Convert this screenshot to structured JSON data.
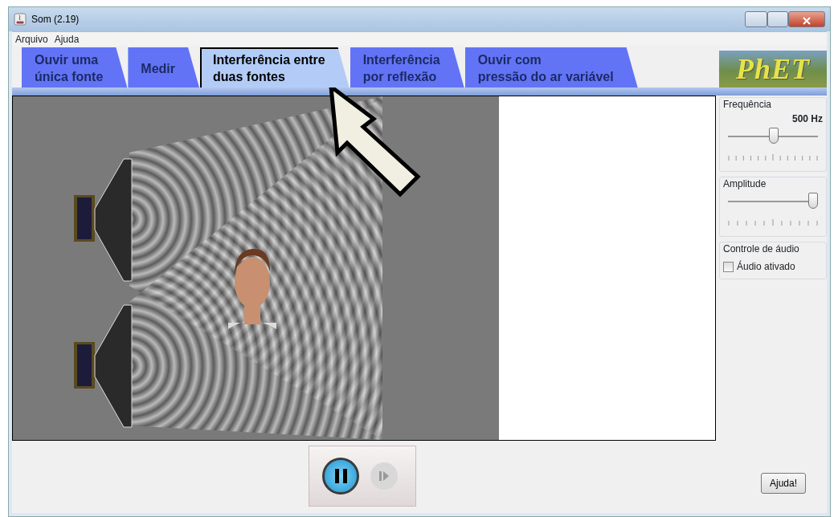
{
  "window": {
    "title": "Som (2.19)"
  },
  "menu": [
    "Arquivo",
    "Ajuda"
  ],
  "tabs": [
    {
      "label": "Ouvir uma\núnica fonte",
      "selected": false
    },
    {
      "label": "Medir",
      "selected": false
    },
    {
      "label": "Interferência entre\nduas fontes",
      "selected": true
    },
    {
      "label": "Interferência\npor reflexão",
      "selected": false
    },
    {
      "label": "Ouvir com\npressão do ar variável",
      "selected": false
    }
  ],
  "logo": "PhET",
  "controls": {
    "frequency": {
      "title": "Frequência",
      "reading": "500 Hz",
      "level": 0.51
    },
    "amplitude": {
      "title": "Amplitude",
      "level": 1.0
    },
    "audio": {
      "title": "Controle de áudio",
      "label": "Áudio ativado",
      "checked": false
    }
  },
  "playback": {
    "paused": false,
    "step_disabled": true
  },
  "help_button": "Ajuda!"
}
